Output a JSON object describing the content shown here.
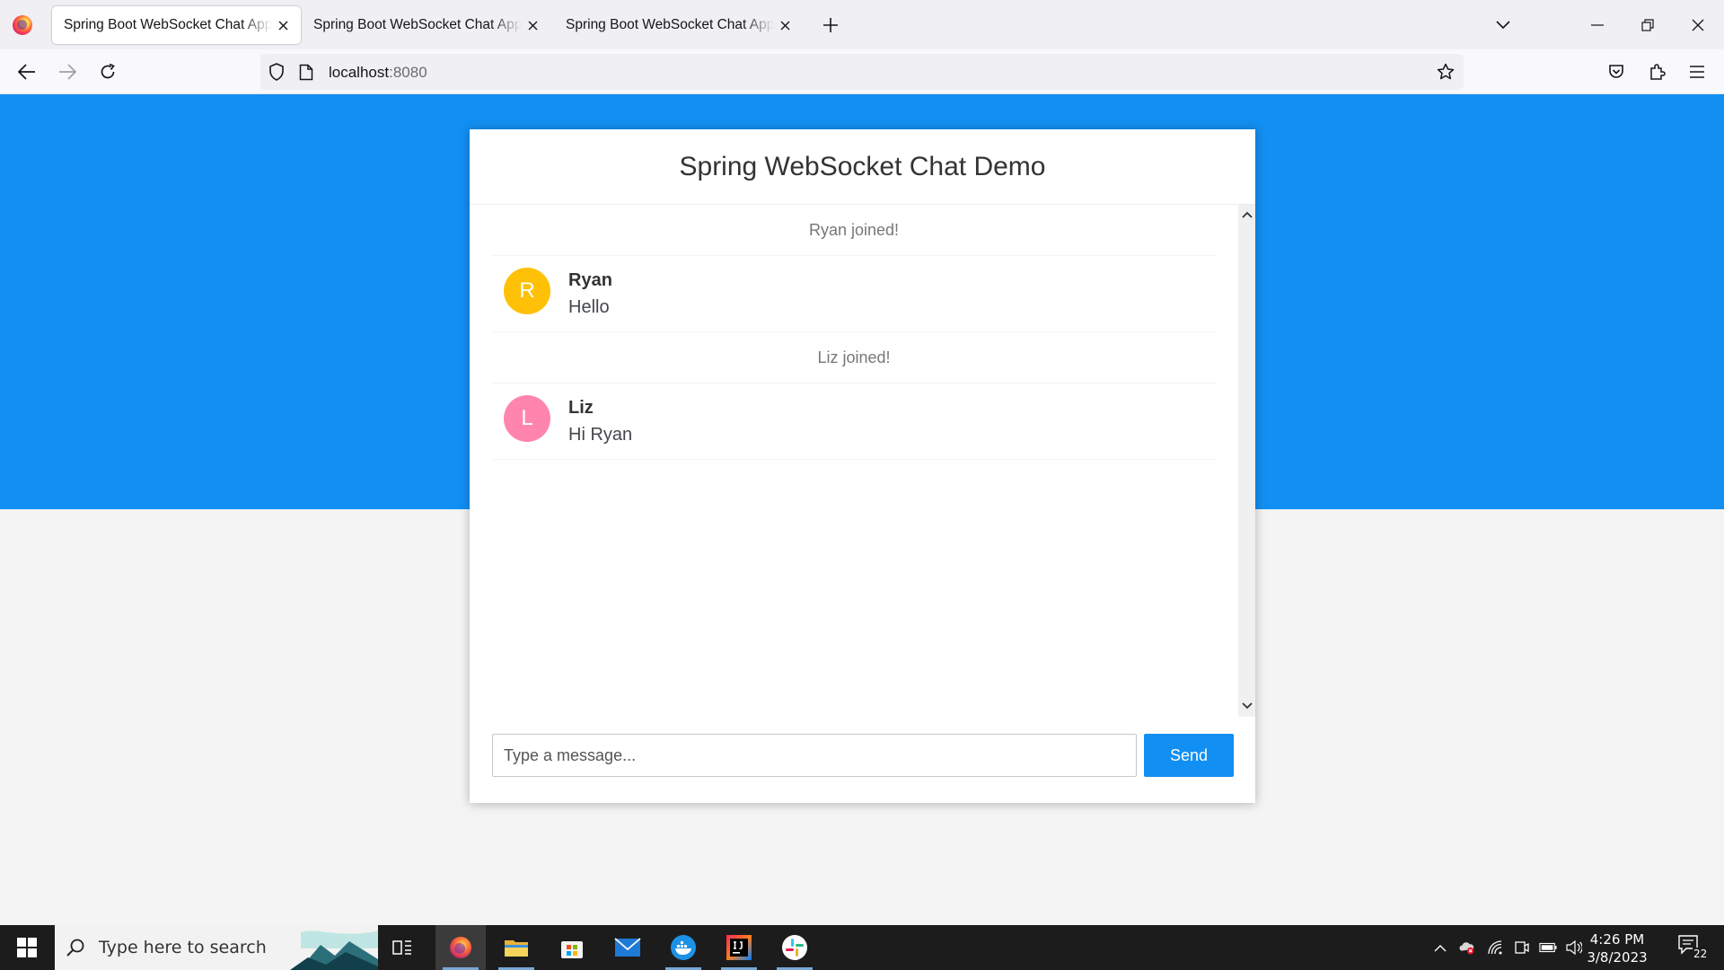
{
  "browser": {
    "tabs": [
      {
        "title": "Spring Boot WebSocket Chat Application"
      },
      {
        "title": "Spring Boot WebSocket Chat Application"
      },
      {
        "title": "Spring Boot WebSocket Chat Application"
      }
    ],
    "url": {
      "host": "localhost",
      "port": ":8080"
    }
  },
  "chat": {
    "title": "Spring WebSocket Chat Demo",
    "messages": [
      {
        "type": "event",
        "text": "Ryan joined!"
      },
      {
        "type": "chat",
        "sender": "Ryan",
        "initial": "R",
        "text": "Hello",
        "avatar_color": "#ffc107"
      },
      {
        "type": "event",
        "text": "Liz joined!"
      },
      {
        "type": "chat",
        "sender": "Liz",
        "initial": "L",
        "text": "Hi Ryan",
        "avatar_color": "#ff85af"
      }
    ],
    "input_placeholder": "Type a message...",
    "send_label": "Send"
  },
  "colors": {
    "accent": "#128ff2",
    "background": "#f4f4f4"
  },
  "taskbar": {
    "search_placeholder": "Type here to search",
    "time": "4:26 PM",
    "date": "3/8/2023",
    "notification_count": "22",
    "apps": [
      "firefox",
      "file-explorer",
      "microsoft-store",
      "mail",
      "docker",
      "intellij-idea",
      "slack"
    ]
  }
}
